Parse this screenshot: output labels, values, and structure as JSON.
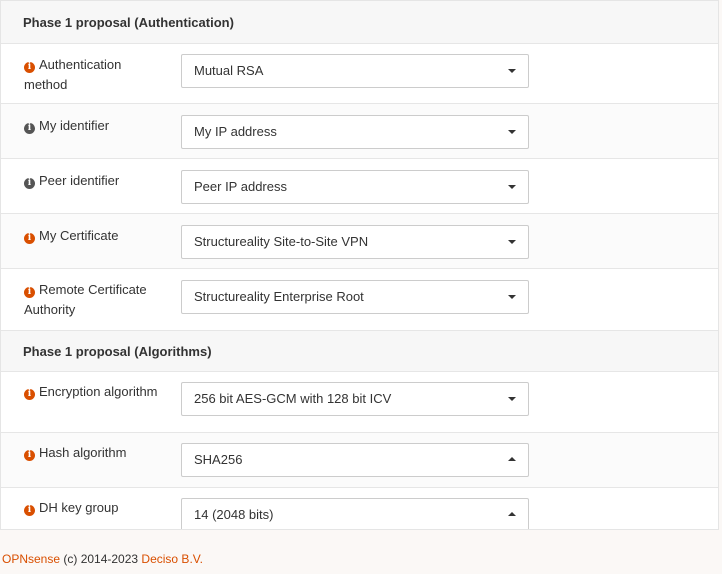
{
  "sections": {
    "auth_header": "Phase 1 proposal (Authentication)",
    "algo_header": "Phase 1 proposal (Algorithms)"
  },
  "fields": {
    "auth_method": {
      "label": "Authentication method",
      "value": "Mutual RSA",
      "info_color": "orange"
    },
    "my_identifier": {
      "label": "My identifier",
      "value": "My IP address",
      "info_color": "grey"
    },
    "peer_identifier": {
      "label": "Peer identifier",
      "value": "Peer IP address",
      "info_color": "grey"
    },
    "my_certificate": {
      "label": "My Certificate",
      "value": "Structureality Site-to-Site VPN",
      "info_color": "orange"
    },
    "remote_ca": {
      "label": "Remote Certificate Authority",
      "value": "Structureality Enterprise Root",
      "info_color": "orange"
    },
    "encryption": {
      "label": "Encryption algorithm",
      "value": "256 bit AES-GCM with 128 bit ICV",
      "info_color": "orange"
    },
    "hash": {
      "label": "Hash algorithm",
      "value": "SHA256",
      "info_color": "orange"
    },
    "dh_group": {
      "label": "DH key group",
      "value": "14 (2048 bits)",
      "info_color": "orange"
    }
  },
  "footer": {
    "brand": "OPNsense",
    "copyright": " (c) 2014-2023 ",
    "company": "Deciso B.V."
  },
  "colors": {
    "accent": "#d94f00",
    "info_grey": "#555555"
  }
}
